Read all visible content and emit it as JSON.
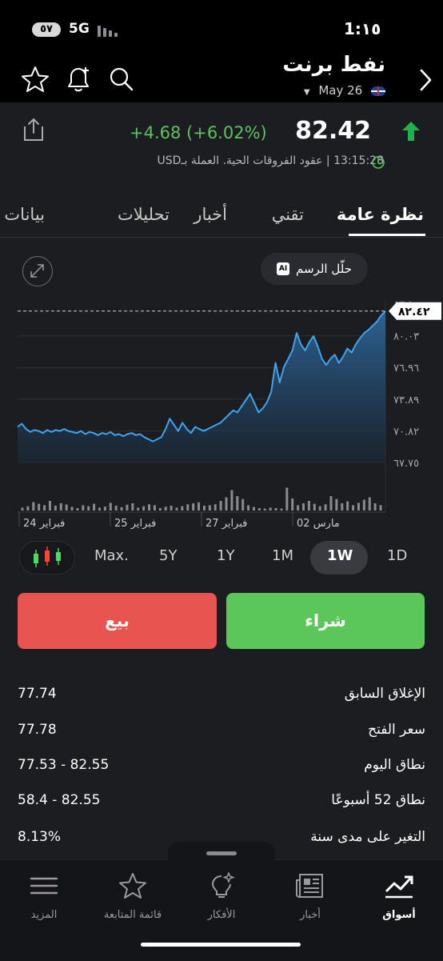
{
  "status_bar": {
    "time": "1:١٥",
    "network": "5G",
    "battery": "٥٧"
  },
  "header": {
    "title": "نفط برنت",
    "date": "May 26",
    "icons": [
      "back-chevron-icon",
      "search-icon",
      "bell-plus-icon",
      "star-icon",
      "share-icon"
    ]
  },
  "quote": {
    "price": "82.42",
    "change": "+4.68 (+6.02%)",
    "meta": "13:15:28 | عقود الفروقات الحية. العملة بـUSD",
    "direction_color": "#22b14c"
  },
  "tabs": [
    {
      "label": "نظرة عامة",
      "active": true
    },
    {
      "label": "تقني"
    },
    {
      "label": "أخبار"
    },
    {
      "label": "تحليلات"
    },
    {
      "label": "بيانات"
    }
  ],
  "chart": {
    "ai_button": "حلّل الرسم",
    "ai_badge": "AI",
    "current_price_label": "٨٢.٤٢"
  },
  "chart_data": {
    "type": "area",
    "y_ticks": [
      "٨٣.١",
      "٨٠.٠٣",
      "٧٦.٩٦",
      "٧٣.٨٩",
      "٧٠.٨٢",
      "٦٧.٧٥"
    ],
    "y_tick_values": [
      83.1,
      80.03,
      76.96,
      73.89,
      70.82,
      67.75
    ],
    "ylim": [
      67.75,
      83.1
    ],
    "x_labels": [
      "24 فبراير",
      "25 فبراير",
      "27 فبراير",
      "02 مارس"
    ],
    "current": 82.42,
    "values": [
      71.2,
      71.5,
      71.0,
      70.7,
      70.9,
      70.8,
      70.6,
      70.9,
      70.7,
      70.9,
      70.8,
      71.0,
      70.8,
      70.7,
      70.6,
      70.8,
      70.5,
      70.7,
      70.6,
      70.4,
      70.6,
      70.5,
      70.7,
      70.4,
      70.5,
      70.3,
      70.5,
      70.6,
      70.4,
      70.5,
      70.2,
      70.0,
      69.8,
      70.0,
      70.2,
      71.0,
      72.0,
      71.4,
      70.8,
      71.6,
      71.0,
      70.6,
      71.2,
      71.0,
      70.8,
      71.0,
      71.2,
      71.4,
      71.6,
      72.0,
      72.4,
      72.8,
      72.6,
      73.2,
      73.8,
      74.4,
      73.5,
      72.6,
      73.0,
      73.6,
      74.6,
      77.4,
      75.5,
      77.0,
      77.8,
      78.6,
      80.3,
      79.2,
      78.6,
      79.4,
      80.0,
      79.0,
      77.8,
      77.2,
      77.8,
      78.2,
      77.4,
      78.0,
      78.8,
      78.4,
      79.2,
      79.8,
      80.3,
      80.6,
      81.0,
      81.4,
      82.0,
      82.42
    ],
    "volume": [
      0.12,
      0.18,
      0.35,
      0.28,
      0.22,
      0.4,
      0.2,
      0.3,
      0.25,
      0.15,
      0.1,
      0.22,
      0.18,
      0.28,
      0.12,
      0.16,
      0.32,
      0.2,
      0.14,
      0.24,
      0.3,
      0.12,
      0.18,
      0.26,
      0.22,
      0.1,
      0.16,
      0.2,
      0.12,
      0.18,
      0.26,
      0.3,
      0.34,
      0.2,
      0.22,
      0.26,
      0.4,
      0.55,
      0.85,
      0.6,
      0.48,
      0.22,
      0.15,
      0.1,
      0.08,
      0.12,
      0.1,
      0.08,
      0.95,
      0.5,
      0.22,
      0.3,
      0.4,
      0.28,
      0.18,
      0.26,
      0.6,
      0.48,
      0.3,
      0.38,
      0.22,
      0.32,
      0.45,
      0.55,
      0.3,
      0.22
    ]
  },
  "timeframes": [
    {
      "label": "1D"
    },
    {
      "label": "1W",
      "active": true
    },
    {
      "label": "1M"
    },
    {
      "label": "1Y"
    },
    {
      "label": "5Y"
    },
    {
      "label": "Max."
    }
  ],
  "actions": {
    "buy": "شراء",
    "sell": "بيع"
  },
  "stats": [
    {
      "label": "الإغلاق السابق",
      "value": "77.74"
    },
    {
      "label": "سعر الفتح",
      "value": "77.78"
    },
    {
      "label": "نطاق اليوم",
      "value": "77.53 - 82.55"
    },
    {
      "label": "نطاق 52 أسبوعًا",
      "value": "58.4 - 82.55"
    },
    {
      "label": "التغير على مدى سنة",
      "value": "8.13%"
    }
  ],
  "bottom_nav": [
    {
      "label": "أسواق",
      "icon": "chart-trend-icon",
      "active": true
    },
    {
      "label": "أخبار",
      "icon": "newspaper-icon"
    },
    {
      "label": "الأفكار",
      "icon": "lightbulb-icon"
    },
    {
      "label": "قائمة المتابعة",
      "icon": "star-outline-icon"
    },
    {
      "label": "المزيد",
      "icon": "menu-icon"
    }
  ]
}
